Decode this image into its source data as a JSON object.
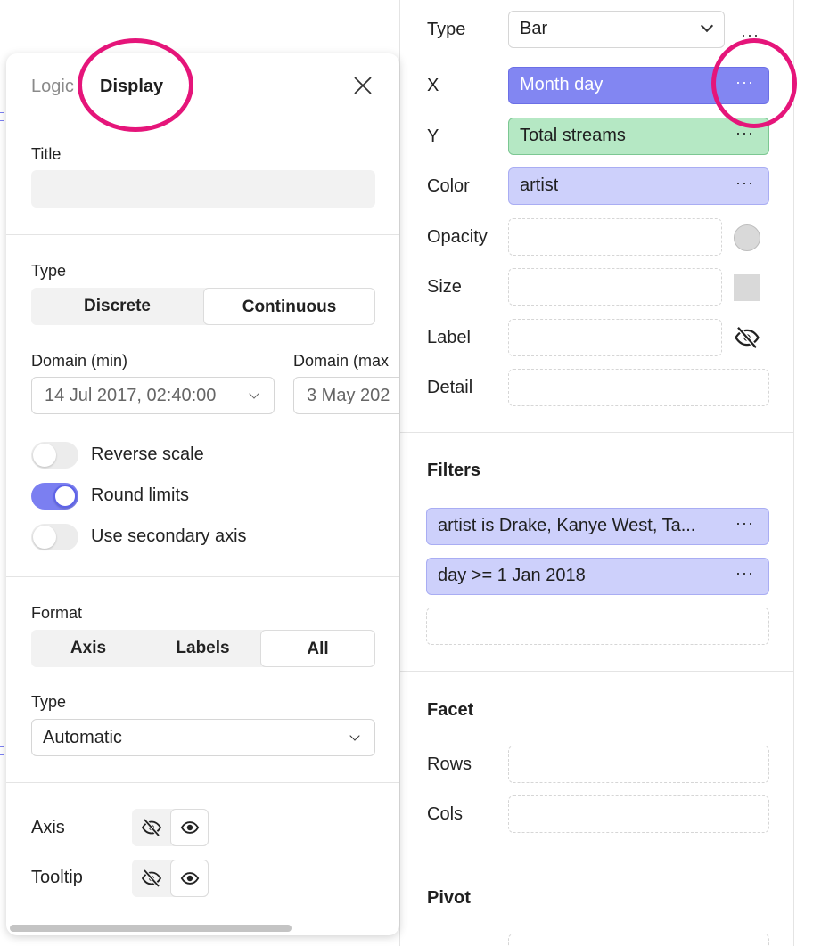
{
  "encoding": {
    "type_label": "Type",
    "type_value": "Bar",
    "type_more": "···",
    "x_label": "X",
    "x_value": "Month day",
    "y_label": "Y",
    "y_value": "Total streams",
    "color_label": "Color",
    "color_value": "artist",
    "opacity_label": "Opacity",
    "size_label": "Size",
    "label_label": "Label",
    "detail_label": "Detail",
    "pill_more": "···"
  },
  "filters": {
    "title": "Filters",
    "items": [
      {
        "text": "artist is Drake, Kanye West, Ta..."
      },
      {
        "text": "day >= 1 Jan 2018"
      }
    ]
  },
  "facet": {
    "title": "Facet",
    "rows_label": "Rows",
    "cols_label": "Cols"
  },
  "pivot": {
    "title": "Pivot"
  },
  "display_panel": {
    "tab_logic": "Logic",
    "tab_display": "Display",
    "title_label": "Title",
    "title_value": "",
    "type_label": "Type",
    "type_options": [
      "Discrete",
      "Continuous"
    ],
    "type_selected": "Continuous",
    "domain_min_label": "Domain (min)",
    "domain_min_value": "14 Jul 2017, 02:40:00",
    "domain_max_label": "Domain (max",
    "domain_max_value": "3 May 202",
    "toggles": [
      {
        "label": "Reverse scale",
        "on": false
      },
      {
        "label": "Round limits",
        "on": true
      },
      {
        "label": "Use secondary axis",
        "on": false
      }
    ],
    "format_label": "Format",
    "format_options": [
      "Axis",
      "Labels",
      "All"
    ],
    "format_selected": "All",
    "format_type_label": "Type",
    "format_type_value": "Automatic",
    "axis_label": "Axis",
    "tooltip_label": "Tooltip"
  },
  "colors": {
    "x_pill_bg": "#8286f2",
    "x_pill_border": "#6b6fe6",
    "y_pill_bg": "#b5e8c4",
    "y_pill_border": "#7cc792",
    "color_pill_bg": "#cdd0fb",
    "color_pill_border": "#a9adf3",
    "highlight": "#e5157a",
    "toggle_on": "#7b7ff1"
  }
}
